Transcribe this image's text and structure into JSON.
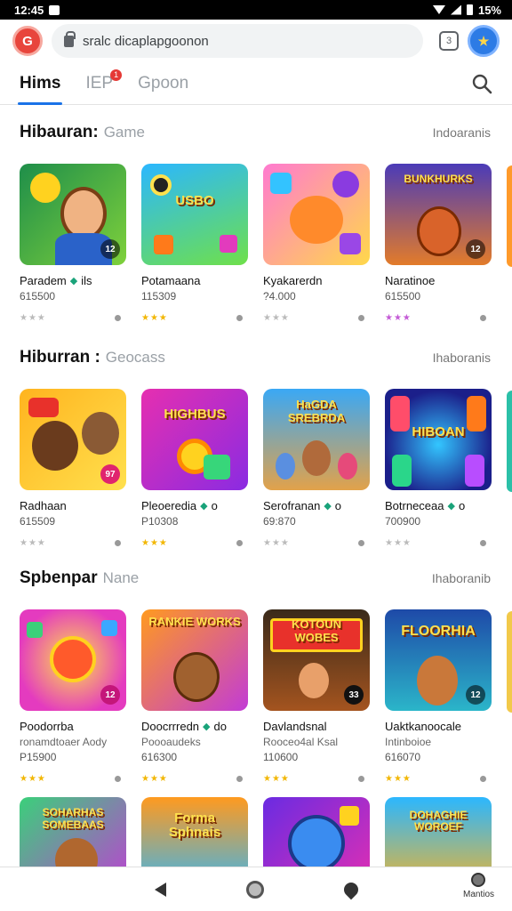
{
  "status_bar": {
    "time": "12:45",
    "battery": "15%"
  },
  "browser": {
    "url": "sralc dicaplapgoonon",
    "tab_count": "3",
    "logo_text": "G"
  },
  "tabs": [
    {
      "label": "Hims",
      "active": true
    },
    {
      "label": "IEP",
      "badge": "1"
    },
    {
      "label": "Gpoon"
    }
  ],
  "sections": [
    {
      "title": "Hibauran:",
      "subtitle": "Game",
      "more": "Indoaranis",
      "cards": [
        {
          "name": "Paradem",
          "tag": "ils",
          "meta": "615500",
          "badge": "12",
          "stars": "★★★",
          "star_color": "#bbb",
          "text": ""
        },
        {
          "name": "Potamaana",
          "tag": "",
          "meta": "115309",
          "badge": "",
          "stars": "★★★",
          "star_color": "#f2b705",
          "text": "USBO"
        },
        {
          "name": "Kyakarerdn",
          "tag": "",
          "meta": "?4.000",
          "badge": "",
          "stars": "★★★",
          "star_color": "#bbb",
          "text": ""
        },
        {
          "name": "Naratinoe",
          "tag": "",
          "meta": "615500",
          "badge": "12",
          "stars": "★★★",
          "star_color": "#c45bd6",
          "text": "BUNKHURKS"
        }
      ]
    },
    {
      "title": "Hiburran :",
      "subtitle": "Geocass",
      "more": "Ihaboranis",
      "cards": [
        {
          "name": "Radhaan",
          "tag": "",
          "meta": "615509",
          "badge": "97",
          "stars": "★★★",
          "star_color": "#bbb",
          "text": ""
        },
        {
          "name": "Pleoeredia",
          "tag": "o",
          "meta": "P10308",
          "badge": "",
          "stars": "★★★",
          "star_color": "#f2b705",
          "text": "HIGHBUS"
        },
        {
          "name": "Serofranan",
          "tag": "o",
          "meta": "69:870",
          "badge": "",
          "stars": "★★★",
          "star_color": "#bbb",
          "text": "HaGDA SREBRDA"
        },
        {
          "name": "Botrneceaa",
          "tag": "o",
          "meta": "700900",
          "badge": "",
          "stars": "★★★",
          "star_color": "#bbb",
          "text": "HIBOAN"
        }
      ]
    },
    {
      "title": "Spbenpar",
      "subtitle": "Nane",
      "more": "Ihaboranib",
      "cards": [
        {
          "name": "Poodorrba",
          "sub": "ronamdtoaer Aody",
          "meta": "P15900",
          "badge": "12",
          "stars": "★★★",
          "star_color": "#f2b705",
          "text": ""
        },
        {
          "name": "Doocrrredn",
          "tag": "do",
          "sub": "Poooaudeks",
          "meta": "616300",
          "badge": "",
          "stars": "★★★",
          "star_color": "#f2b705",
          "text": "RANKIE WORKS"
        },
        {
          "name": "Davlandsnal",
          "sub": "Rooceo4al Ksal",
          "meta": "110600",
          "badge": "33",
          "stars": "★★★",
          "star_color": "#f2b705",
          "text": "KOTOUN WOBES"
        },
        {
          "name": "Uaktkanoocale",
          "sub": "Intinboioe",
          "meta": "616070",
          "badge": "12",
          "stars": "★★★",
          "star_color": "#f2b705",
          "text": "FLOORHIA"
        }
      ]
    },
    {
      "title": "",
      "subtitle": "",
      "more": "",
      "cards": [
        {
          "name": "",
          "meta": "",
          "badge": "",
          "stars": "",
          "text": "SOHARHAS SOMEBAAS"
        },
        {
          "name": "",
          "meta": "",
          "badge": "",
          "stars": "",
          "text": "Forma Sphnais"
        },
        {
          "name": "",
          "meta": "",
          "badge": "",
          "stars": "",
          "text": ""
        },
        {
          "name": "",
          "meta": "",
          "badge": "",
          "stars": "",
          "text": "DOHAGHIE WOROEF"
        }
      ]
    }
  ],
  "bottom_nav": {
    "menu_label": "Mantios"
  }
}
